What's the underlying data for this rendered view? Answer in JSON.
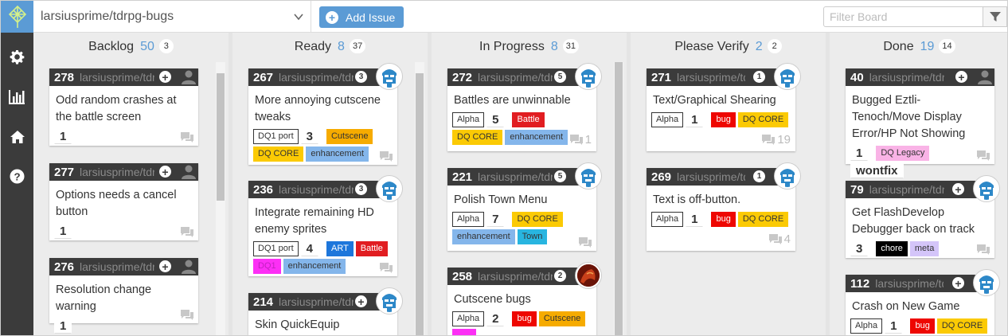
{
  "topbar": {
    "repo_name": "larsiusprime/tdrpg-bugs",
    "add_issue": "Add Issue",
    "filter_placeholder": "Filter Board"
  },
  "colors": {
    "accent": "#5b9bd5",
    "card_header": "#3b3b3b",
    "sidebar": "#3b3b3b"
  },
  "columns": [
    {
      "name": "Backlog",
      "count": "50",
      "badge": "3"
    },
    {
      "name": "Ready",
      "count": "8",
      "badge": "37"
    },
    {
      "name": "In Progress",
      "count": "8",
      "badge": "31"
    },
    {
      "name": "Please Verify",
      "count": "2",
      "badge": "2"
    },
    {
      "name": "Done",
      "count": "19",
      "badge": "14"
    }
  ],
  "cards": {
    "c278": {
      "number": "278",
      "repo": "larsiusprime/tdrpg-bugs",
      "title": "Odd random crashes at the battle screen",
      "labels": [
        "1"
      ]
    },
    "c277": {
      "number": "277",
      "repo": "larsiusprime/tdrpg-bugs",
      "title": "Options needs a cancel button",
      "labels": [
        "1"
      ]
    },
    "c276": {
      "number": "276",
      "repo": "larsiusprime/tdrpg-bugs",
      "title": "Resolution change warning",
      "labels": [
        "1"
      ]
    },
    "c267": {
      "number": "267",
      "repo": "larsiusprime/tdrpg-bugs",
      "assignee_count": "3",
      "title": "More annoying cutscene tweaks",
      "labels": [
        "DQ1 port",
        "3",
        "Cutscene",
        "DQ CORE",
        "enhancement"
      ]
    },
    "c236": {
      "number": "236",
      "repo": "larsiusprime/tdrpg-bugs",
      "assignee_count": "3",
      "title": "Integrate remaining HD enemy sprites",
      "labels": [
        "DQ1 port",
        "4",
        "ART",
        "Battle",
        "DQ1",
        "enhancement"
      ]
    },
    "c214": {
      "number": "214",
      "repo": "larsiusprime/tdrpg-bugs",
      "title": "Skin QuickEquip"
    },
    "c272": {
      "number": "272",
      "repo": "larsiusprime/tdrpg-bugs",
      "assignee_count": "5",
      "title": "Battles are unwinnable",
      "labels": [
        "Alpha",
        "5",
        "Battle",
        "DQ CORE",
        "enhancement"
      ],
      "comments": "1"
    },
    "c221": {
      "number": "221",
      "repo": "larsiusprime/tdrpg-bugs",
      "assignee_count": "5",
      "title": "Polish Town Menu",
      "labels": [
        "Alpha",
        "7",
        "DQ CORE",
        "enhancement",
        "Town"
      ]
    },
    "c258": {
      "number": "258",
      "repo": "larsiusprime/tdrpg-bugs",
      "assignee_count": "2",
      "title": "Cutscene bugs",
      "labels": [
        "Alpha",
        "2",
        "bug",
        "Cutscene"
      ]
    },
    "c271": {
      "number": "271",
      "repo": "larsiusprime/tdrpg-bugs",
      "assignee_count": "1",
      "title": "Text/Graphical Shearing",
      "labels": [
        "Alpha",
        "1",
        "bug",
        "DQ CORE"
      ],
      "comments": "19"
    },
    "c269": {
      "number": "269",
      "repo": "larsiusprime/tdrpg-bugs",
      "assignee_count": "1",
      "title": "Text is off-button.",
      "labels": [
        "Alpha",
        "1",
        "bug",
        "DQ CORE"
      ],
      "comments": "4"
    },
    "c40": {
      "number": "40",
      "repo": "larsiusprime/tdrpg-bugs",
      "title": "Bugged Eztli-Tenoch/Move Display Error/HP Not Showing",
      "labels": [
        "1",
        "DQ Legacy",
        "wontfix"
      ]
    },
    "c79": {
      "number": "79",
      "repo": "larsiusprime/tdrpg-bugs",
      "title": "Get FlashDevelop Debugger back on track",
      "labels": [
        "3",
        "chore",
        "meta"
      ]
    },
    "c112": {
      "number": "112",
      "repo": "larsiusprime/tdrpg-bugs",
      "title": "Crash on New Game",
      "labels": [
        "Alpha",
        "1",
        "bug",
        "DQ CORE"
      ]
    }
  },
  "label_colors": {
    "Cutscene": "#f6ab00",
    "DQ CORE": "#fbca04",
    "enhancement": "#84b6eb",
    "ART": "#1d76db",
    "Battle": "#e11d21",
    "DQ1": "#fc2ff5",
    "bug": "#ee0701",
    "Town": "#28b5e0",
    "DQ Legacy": "#f9b3e6",
    "chore": "#000000",
    "meta": "#d4c5f9"
  }
}
